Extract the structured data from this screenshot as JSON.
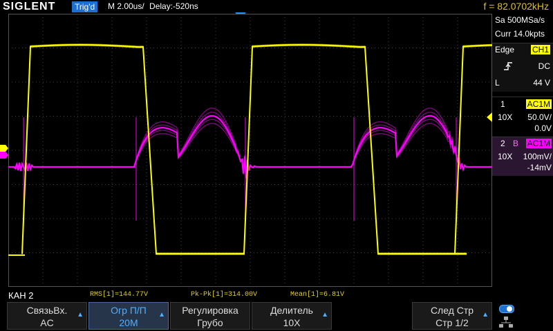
{
  "header": {
    "logo": "SIGLENT",
    "trigger_state": "Trig'd",
    "timebase": "M 2.00us/",
    "delay": "Delay:-520ns",
    "frequency": "f = 82.0702kHz"
  },
  "acquisition": {
    "sample_rate": "Sa 500MSa/s",
    "memory": "Curr 14.0kpts"
  },
  "trigger": {
    "type_label": "Edge",
    "source": "CH1",
    "coupling": "DC",
    "level_prefix": "L",
    "level": "44 V",
    "slope_icon": "rising-edge-icon"
  },
  "channel1": {
    "number": "1",
    "coupling": "AC1M",
    "probe": "10X",
    "scale": "50.0V/",
    "offset": "0.0V",
    "color": "#ffff00"
  },
  "channel2": {
    "number": "2",
    "bw_flag": "B",
    "coupling": "AC1M",
    "probe": "10X",
    "scale": "100mV/",
    "offset": "-14mV",
    "color": "#ff00ff"
  },
  "status": {
    "menu_label": "КАН 2"
  },
  "measurements": [
    {
      "label": "RMS[1]=144.77V"
    },
    {
      "label": "Pk-Pk[1]=314.00V"
    },
    {
      "label": "Mean[1]=6.81V"
    }
  ],
  "softkeys": [
    {
      "line1": "СвязьВх.",
      "line2": "AC",
      "arrow": "▲"
    },
    {
      "line1": "Огр П/П",
      "line2": "20M",
      "arrow": "▲"
    },
    {
      "line1": "Регулировка",
      "line2": "Грубо",
      "arrow": ""
    },
    {
      "line1": "Делитель",
      "line2": "10X",
      "arrow": "▲"
    },
    {
      "line1": "След Стр",
      "line2": "Стр 1/2",
      "arrow": "▲"
    }
  ],
  "colors": {
    "ch1": "#ffff00",
    "ch2": "#ff00ff",
    "accent": "#1e6fd0"
  }
}
